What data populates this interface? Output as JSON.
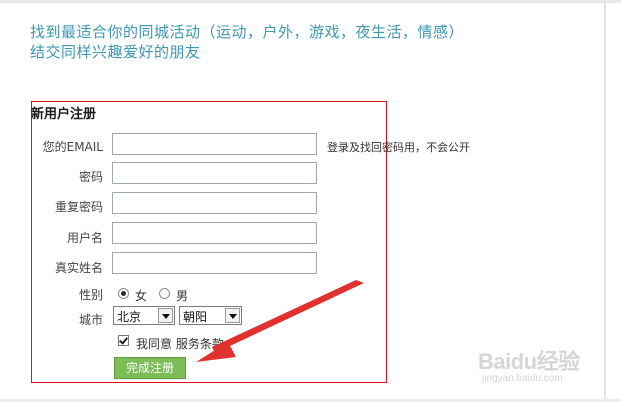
{
  "tagline": {
    "line1": "找到最适合你的同城活动（运动，户外，游戏，夜生活，情感）",
    "line2": "结交同样兴趣爱好的朋友"
  },
  "form": {
    "title": "新用户注册",
    "email_label": "您的EMAIL",
    "email_hint": "登录及找回密码用，不会公开",
    "password_label": "密码",
    "confirm_password_label": "重复密码",
    "username_label": "用户名",
    "realname_label": "真实姓名",
    "gender_label": "性别",
    "gender_female": "女",
    "gender_male": "男",
    "gender_selected": "女",
    "city_label": "城市",
    "city_value": "北京",
    "district_value": "朝阳",
    "agree_text": "我同意",
    "terms_link": "服务条款",
    "agree_checked": true,
    "submit_label": "完成注册"
  },
  "watermark": {
    "brand": "Baidu经验",
    "url": "jingyan.baidu.com"
  },
  "colors": {
    "tagline": "#3d97b3",
    "box_border": "#d9121b",
    "button": "#7cbd57",
    "annotation_arrow": "#e0312f"
  }
}
